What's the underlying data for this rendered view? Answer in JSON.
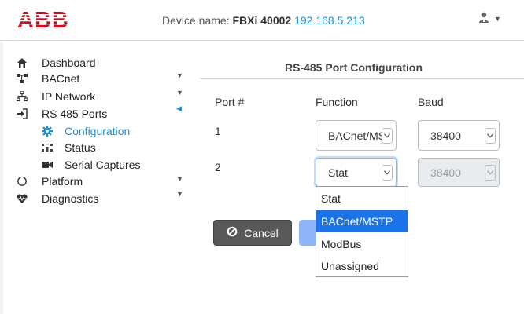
{
  "header": {
    "brand_logo": "ABB",
    "device_label": "Device name: ",
    "device_name": "FBXi 40002",
    "device_ip": "192.168.5.213",
    "user_icon": "user-icon"
  },
  "sidebar": {
    "items": [
      {
        "label": "Dashboard",
        "icon": "home-icon"
      },
      {
        "label": "BACnet",
        "icon": "network-tree-icon"
      },
      {
        "label": "IP Network",
        "icon": "sitemap-icon"
      },
      {
        "label": "RS 485 Ports",
        "icon": "sign-in-icon"
      },
      {
        "label": "Configuration",
        "icon": "gear-icon"
      },
      {
        "label": "Status",
        "icon": "status-grid-icon"
      },
      {
        "label": "Serial Captures",
        "icon": "video-camera-icon"
      },
      {
        "label": "Platform",
        "icon": "power-icon"
      },
      {
        "label": "Diagnostics",
        "icon": "heartbeat-icon"
      }
    ],
    "active_item": "Configuration",
    "accent_color": "#1a8fd1"
  },
  "main": {
    "title": "RS-485 Port Configuration",
    "columns": [
      "Port #",
      "Function",
      "Baud"
    ],
    "rows": [
      {
        "port": "1",
        "function": "BACnet/MSTP",
        "baud": "38400",
        "baud_disabled": false
      },
      {
        "port": "2",
        "function": "Stat",
        "baud": "38400",
        "baud_disabled": true
      }
    ],
    "function_dropdown": {
      "options": [
        "Stat",
        "BACnet/MSTP",
        "ModBus",
        "Unassigned"
      ],
      "highlighted": "BACnet/MSTP",
      "highlight_color": "#1a73e8"
    },
    "buttons": {
      "cancel_label": "Cancel",
      "cancel_icon": "ban-icon"
    }
  }
}
